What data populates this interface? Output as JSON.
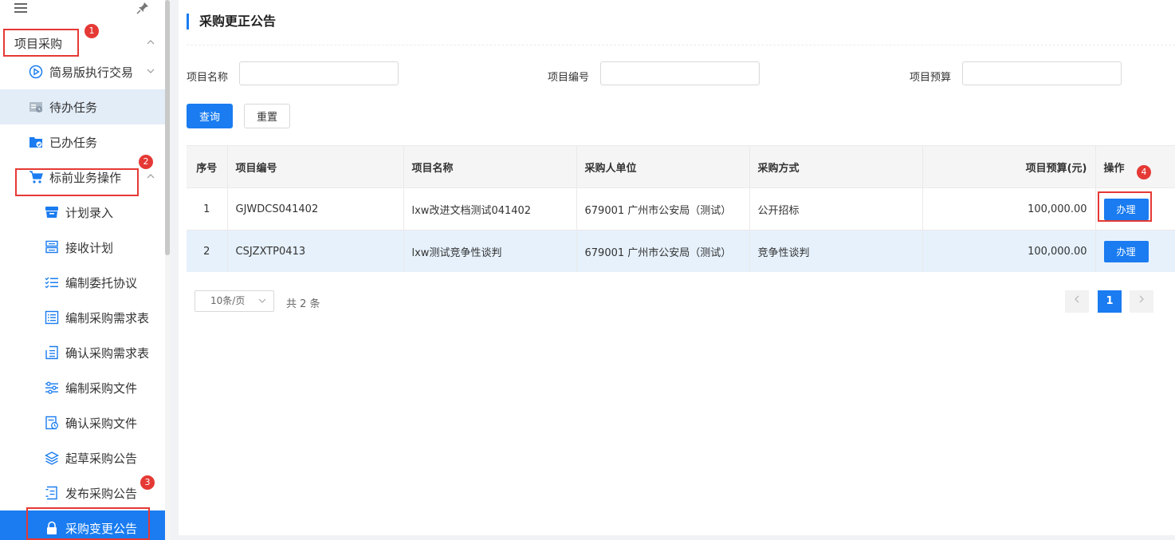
{
  "sidebar": {
    "items": [
      {
        "label": "项目采购",
        "icon": "none",
        "level": 0,
        "state": "expanded"
      },
      {
        "label": "简易版执行交易",
        "icon": "play-circle-icon",
        "level": 1,
        "state": "collapsed"
      },
      {
        "label": "待办任务",
        "icon": "todo-list-icon",
        "level": 1,
        "state": "hover"
      },
      {
        "label": "已办任务",
        "icon": "done-folder-icon",
        "level": 1,
        "state": "normal"
      },
      {
        "label": "标前业务操作",
        "icon": "cart-icon",
        "level": 1,
        "state": "expanded"
      },
      {
        "label": "计划录入",
        "icon": "inbox-icon",
        "level": 2
      },
      {
        "label": "接收计划",
        "icon": "receive-icon",
        "level": 2
      },
      {
        "label": "编制委托协议",
        "icon": "checklist-icon",
        "level": 2
      },
      {
        "label": "编制采购需求表",
        "icon": "list-icon",
        "level": 2
      },
      {
        "label": "确认采购需求表",
        "icon": "confirm-list-icon",
        "level": 2
      },
      {
        "label": "编制采购文件",
        "icon": "sliders-icon",
        "level": 2
      },
      {
        "label": "确认采购文件",
        "icon": "file-check-icon",
        "level": 2
      },
      {
        "label": "起草采购公告",
        "icon": "layers-icon",
        "level": 2
      },
      {
        "label": "发布采购公告",
        "icon": "publish-icon",
        "level": 2
      },
      {
        "label": "采购变更公告",
        "icon": "lock-icon",
        "level": 2,
        "state": "active"
      }
    ],
    "annotations": [
      "1",
      "2",
      "3"
    ]
  },
  "main": {
    "title": "采购更正公告",
    "filters": {
      "name_label": "项目名称",
      "code_label": "项目编号",
      "budget_label": "项目预算",
      "name_value": "",
      "code_value": "",
      "budget_value": ""
    },
    "buttons": {
      "query": "查询",
      "reset": "重置"
    },
    "table": {
      "headers": [
        "序号",
        "项目编号",
        "项目名称",
        "采购人单位",
        "采购方式",
        "项目预算(元)",
        "操作"
      ],
      "rows": [
        {
          "idx": "1",
          "code": "GJWDCS041402",
          "name": "lxw改进文档测试041402",
          "unit": "679001 广州市公安局（测试）",
          "method": "公开招标",
          "budget": "100,000.00",
          "action": "办理"
        },
        {
          "idx": "2",
          "code": "CSJZXTP0413",
          "name": "lxw测试竞争性谈判",
          "unit": "679001 广州市公安局（测试）",
          "method": "竞争性谈判",
          "budget": "100,000.00",
          "action": "办理"
        }
      ]
    },
    "pagination": {
      "page_size": "10条/页",
      "total": "共 2 条",
      "current_page": "1"
    },
    "annotation": "4"
  },
  "colors": {
    "accent": "#1a7cf0",
    "annotation": "#e53935",
    "row_alt": "#e6f1fc"
  }
}
